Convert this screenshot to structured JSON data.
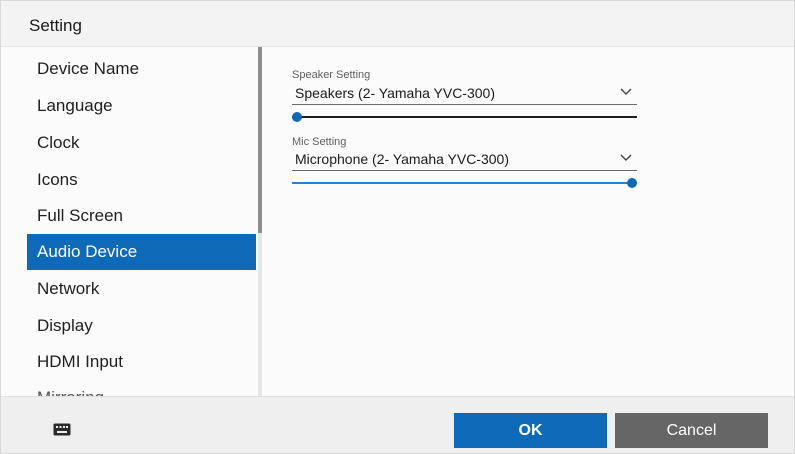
{
  "window": {
    "title": "Setting"
  },
  "sidebar": {
    "items": [
      {
        "label": "Device Name",
        "active": false
      },
      {
        "label": "Language",
        "active": false
      },
      {
        "label": "Clock",
        "active": false
      },
      {
        "label": "Icons",
        "active": false
      },
      {
        "label": "Full Screen",
        "active": false
      },
      {
        "label": "Audio Device",
        "active": true
      },
      {
        "label": "Network",
        "active": false
      },
      {
        "label": "Display",
        "active": false
      },
      {
        "label": "HDMI Input",
        "active": false
      },
      {
        "label": "Mirroring",
        "active": false
      }
    ]
  },
  "audio": {
    "speaker": {
      "label": "Speaker Setting",
      "selected": "Speakers (2- Yamaha YVC-300)",
      "volume_fraction": 0.0
    },
    "mic": {
      "label": "Mic Setting",
      "selected": "Microphone (2- Yamaha YVC-300)",
      "volume_fraction": 1.0
    }
  },
  "footer": {
    "keyboard_icon": "keyboard-icon",
    "ok_label": "OK",
    "cancel_label": "Cancel"
  },
  "colors": {
    "accent": "#0e6ab9",
    "cancel_button": "#666666"
  }
}
